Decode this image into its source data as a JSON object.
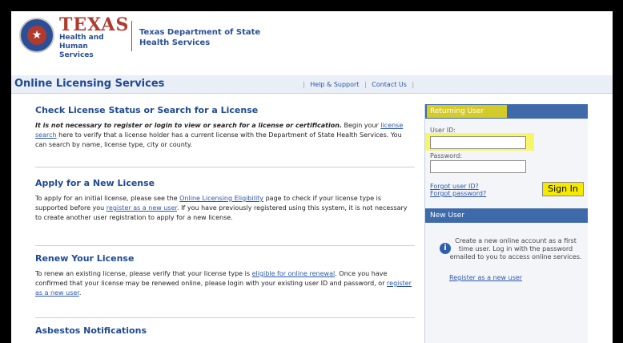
{
  "header": {
    "texas": "TEXAS",
    "hhs_line1": "Health and Human",
    "hhs_line2": "Services",
    "dshs_line1": "Texas Department of State",
    "dshs_line2": "Health Services"
  },
  "titlebar": {
    "title": "Online Licensing Services",
    "help": "Help & Support",
    "contact": "Contact Us"
  },
  "check": {
    "heading": "Check License Status or Search for a License",
    "bold_intro": "It is not necessary to register or login to view or search for a license or certification.",
    "text1": "Begin your",
    "link": "license search",
    "text2": "here to verify that a license holder has a current license with the Department of State Health Services. You can search by name, license type, city or county."
  },
  "apply": {
    "heading": "Apply for a New License",
    "text1": "To apply for an initial license, please see the",
    "link1": "Online Licensing Eligibility",
    "text2": "page to check if your license type is supported before you",
    "link2": "register as a new user",
    "text3": ". If you have previously registered using this system, it is not necessary to create another user registration to apply for a new license."
  },
  "renew": {
    "heading": "Renew Your License",
    "text1": "To renew an existing license, please verify that your license type is",
    "link1": "eligible for online renewal",
    "text2": ". Once you have confirmed that your license may be renewed online, please login with your existing user ID and password, or",
    "link2": "register as a new user",
    "text3": "."
  },
  "asbestos": {
    "heading": "Asbestos Notifications"
  },
  "panel": {
    "returning": "Returning User",
    "userid_label": "User ID:",
    "password_label": "Password:",
    "forgot_user": "Forgot user ID?",
    "forgot_password": "Forgot password?",
    "signin": "Sign In",
    "newuser": "New User",
    "info_text": "Create a new online account as a first time user. Log in with the password emailed to you to access online services.",
    "register_link": "Register as a new user"
  }
}
